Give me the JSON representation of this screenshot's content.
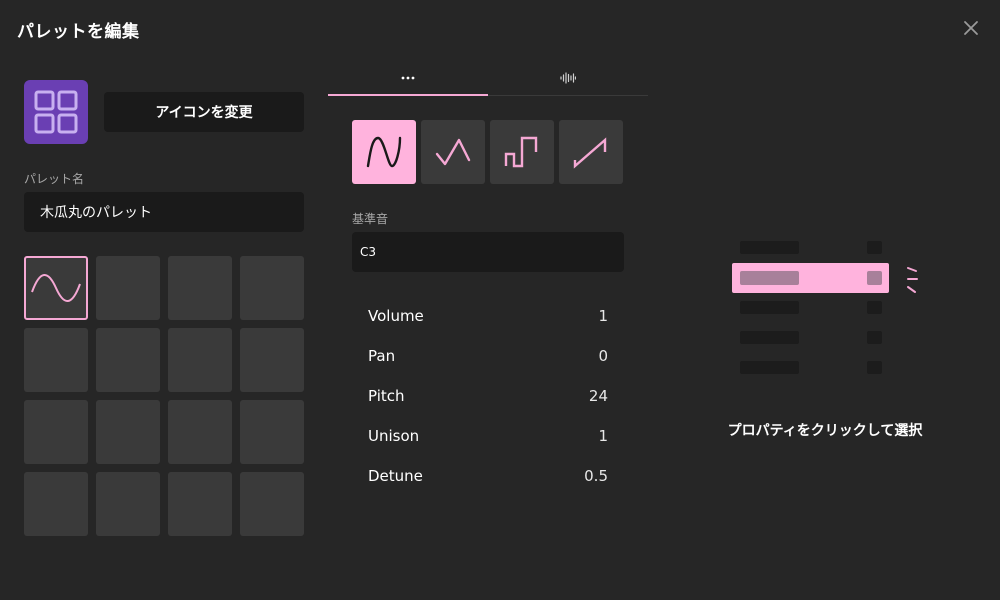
{
  "dialog": {
    "title": "パレットを編集"
  },
  "icon": {
    "change_label": "アイコンを変更",
    "tile_color": "#6a3fb3"
  },
  "palette": {
    "name_label": "パレット名",
    "name_value": "木瓜丸のパレット"
  },
  "slots": {
    "count": 16,
    "active_index": 0
  },
  "tabs": [
    {
      "icon": "more-dots-icon",
      "active": true
    },
    {
      "icon": "waveform-icon",
      "active": false
    }
  ],
  "waveforms": [
    {
      "icon": "sine-wave-icon",
      "selected": true
    },
    {
      "icon": "triangle-wave-icon",
      "selected": false
    },
    {
      "icon": "square-wave-icon",
      "selected": false
    },
    {
      "icon": "sawtooth-wave-icon",
      "selected": false
    }
  ],
  "base_pitch": {
    "label": "基準音",
    "value": "C3"
  },
  "properties": [
    {
      "name": "Volume",
      "value": "1"
    },
    {
      "name": "Pan",
      "value": "0"
    },
    {
      "name": "Pitch",
      "value": "24"
    },
    {
      "name": "Unison",
      "value": "1"
    },
    {
      "name": "Detune",
      "value": "0.5"
    }
  ],
  "hint": {
    "text": "プロパティをクリックして選択"
  },
  "colors": {
    "accent": "#f5a8d4",
    "accent_fill": "#ffb3dd",
    "background": "#262626",
    "field": "#1a1a1a",
    "slot": "#3a3a3a"
  }
}
